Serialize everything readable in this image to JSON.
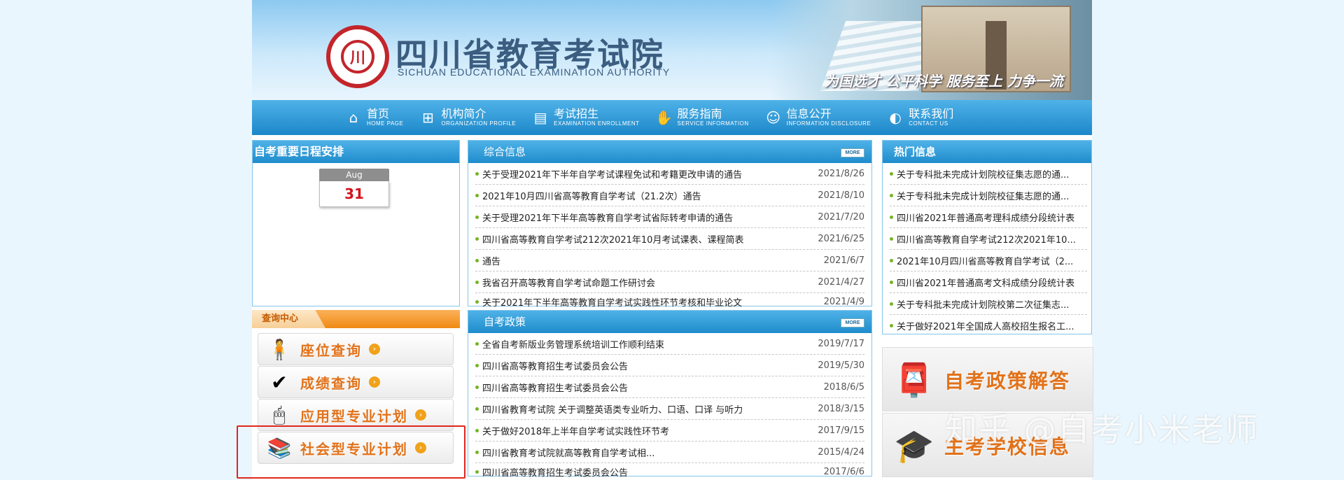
{
  "header": {
    "site_name": "四川省教育考试院",
    "site_name_en": "SICHUAN EDUCATIONAL EXAMINATION AUTHORITY",
    "slogan": "为国选才 公平科学 服务至上 力争一流"
  },
  "nav": [
    {
      "cn": "首页",
      "en": "HOME PAGE",
      "icon": "home-icon"
    },
    {
      "cn": "机构简介",
      "en": "ORGANIZATION PROFILE",
      "icon": "org-chart-icon"
    },
    {
      "cn": "考试招生",
      "en": "EXAMINATION ENROLLMENT",
      "icon": "calendar-icon"
    },
    {
      "cn": "服务指南",
      "en": "SERVICE INFORMATION",
      "icon": "handshake-icon"
    },
    {
      "cn": "信息公开",
      "en": "INFORMATION DISCLOSURE",
      "icon": "people-icon"
    },
    {
      "cn": "联系我们",
      "en": "CONTACT US",
      "icon": "globe-icon"
    }
  ],
  "schedule": {
    "title": "自考重要日程安排",
    "month": "Aug",
    "day": "31"
  },
  "query": {
    "title": "查询中心",
    "buttons": [
      {
        "label": "座位查询"
      },
      {
        "label": "成绩查询"
      },
      {
        "label": "应用型专业计划"
      },
      {
        "label": "社会型专业计划"
      }
    ]
  },
  "news": {
    "title": "综合信息",
    "more": "MORE",
    "items": [
      {
        "title": "关于受理2021年下半年自学考试课程免试和考籍更改申请的通告",
        "date": "2021/8/26"
      },
      {
        "title": "2021年10月四川省高等教育自学考试（21.2次）通告",
        "date": "2021/8/10"
      },
      {
        "title": "关于受理2021年下半年高等教育自学考试省际转考申请的通告",
        "date": "2021/7/20"
      },
      {
        "title": "四川省高等教育自学考试212次2021年10月考试课表、课程简表",
        "date": "2021/6/25"
      },
      {
        "title": "通告",
        "date": "2021/6/7"
      },
      {
        "title": "我省召开高等教育自学考试命题工作研讨会",
        "date": "2021/4/27"
      },
      {
        "title": "关于2021年下半年高等教育自学考试实践性环节考核和毕业论文",
        "date": "2021/4/9"
      }
    ]
  },
  "policy": {
    "title": "自考政策",
    "more": "MORE",
    "items": [
      {
        "title": "全省自考新版业务管理系统培训工作顺利结束",
        "date": "2019/7/17"
      },
      {
        "title": "四川省高等教育招生考试委员会公告",
        "date": "2019/5/30"
      },
      {
        "title": "四川省高等教育招生考试委员会公告",
        "date": "2018/6/5"
      },
      {
        "title": "四川省教育考试院 关于调整英语类专业听力、口语、口译 与听力",
        "date": "2018/3/15"
      },
      {
        "title": "关于做好2018年上半年自学考试实践性环节考",
        "date": "2017/9/15"
      },
      {
        "title": "四川省教育考试院就高等教育自学考试相...",
        "date": "2015/4/24"
      },
      {
        "title": "四川省高等教育招生考试委员会公告",
        "date": "2017/6/6"
      }
    ]
  },
  "hot": {
    "title": "热门信息",
    "items": [
      {
        "title": "关于专科批未完成计划院校征集志愿的通..."
      },
      {
        "title": "关于专科批未完成计划院校征集志愿的通..."
      },
      {
        "title": "四川省2021年普通高考理科成绩分段统计表"
      },
      {
        "title": "四川省高等教育自学考试212次2021年10..."
      },
      {
        "title": "2021年10月四川省高等教育自学考试（2..."
      },
      {
        "title": "四川省2021年普通高考文科成绩分段统计表"
      },
      {
        "title": "关于专科批未完成计划院校第二次征集志..."
      },
      {
        "title": "关于做好2021年全国成人高校招生报名工..."
      }
    ]
  },
  "promos": [
    {
      "label": "自考政策解答",
      "icon": "mailbox-icon"
    },
    {
      "label": "主考学校信息",
      "icon": "graduation-cap-icon"
    }
  ],
  "watermark": "知乎 @自考小米老师"
}
